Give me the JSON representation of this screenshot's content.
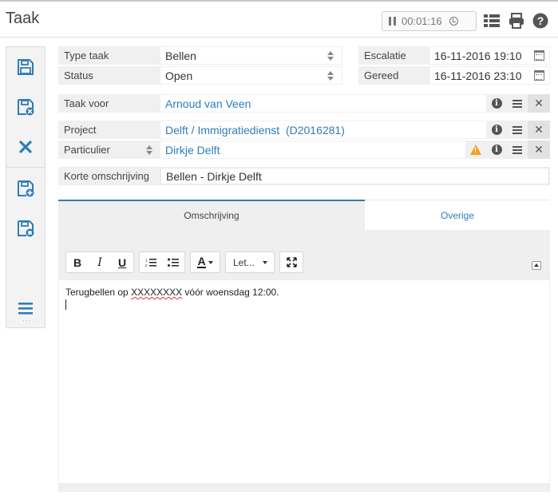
{
  "header": {
    "title": "Taak",
    "timer": "00:01:16"
  },
  "form": {
    "type_taak": {
      "label": "Type taak",
      "value": "Bellen"
    },
    "status": {
      "label": "Status",
      "value": "Open"
    },
    "escalatie": {
      "label": "Escalatie",
      "value": "16-11-2016 19:10"
    },
    "gereed": {
      "label": "Gereed",
      "value": "16-11-2016 23:10"
    },
    "taak_voor": {
      "label": "Taak voor",
      "value": "Arnoud van Veen"
    },
    "project": {
      "label": "Project",
      "value": "Delft / Immigratiedienst  (D2016281)"
    },
    "particulier": {
      "label": "Particulier",
      "value": "Dirkje Delft"
    },
    "korte_omschrijving": {
      "label": "Korte omschrijving",
      "value": "Bellen - Dirkje Delft"
    }
  },
  "tabs": {
    "omschrijving": "Omschrijving",
    "overige": "Overige"
  },
  "editor": {
    "bold": "B",
    "italic": "I",
    "underline": "U",
    "font_color": "A",
    "font_select": "Let...",
    "content_prefix": "Terugbellen op ",
    "content_misspelled": "XXXXXXXX",
    "content_suffix": " vóór woensdag 12:00."
  },
  "colors": {
    "accent": "#2e7db8",
    "warning": "#f0a020"
  },
  "icons": [
    "pause-icon",
    "clock-icon",
    "list-view-icon",
    "print-icon",
    "help-icon",
    "save-icon",
    "save-close-icon",
    "close-icon",
    "save-new-icon",
    "save-copy-icon",
    "menu-icon",
    "calendar-icon",
    "info-icon",
    "warning-icon"
  ]
}
